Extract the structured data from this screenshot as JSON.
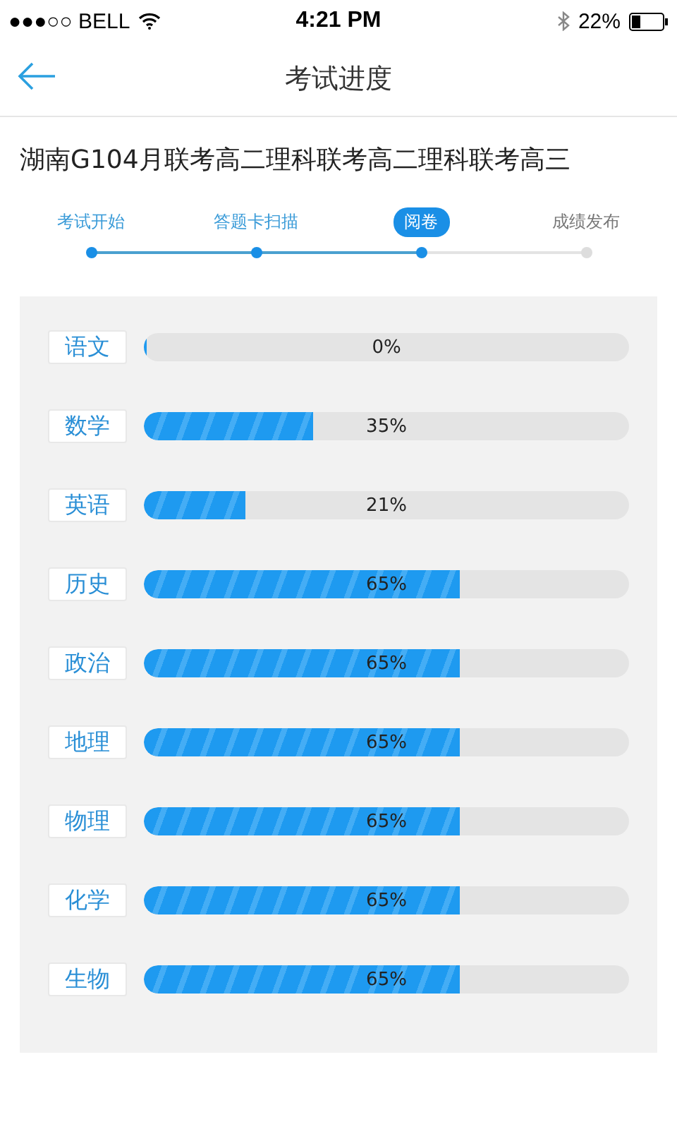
{
  "status_bar": {
    "carrier": "●●●○○ BELL",
    "time": "4:21 PM",
    "battery": "22%"
  },
  "nav": {
    "title": "考试进度"
  },
  "exam_name": "湖南G104月联考高二理科联考高二理科联考高三",
  "steps": [
    {
      "label": "考试开始",
      "done": true,
      "selected": false
    },
    {
      "label": "答题卡扫描",
      "done": true,
      "selected": false
    },
    {
      "label": "阅卷",
      "done": true,
      "selected": true
    },
    {
      "label": "成绩发布",
      "done": false,
      "selected": false
    }
  ],
  "subjects": [
    {
      "name": "语文",
      "level": 0,
      "reading": "0%"
    },
    {
      "name": "数学",
      "level": 0.35,
      "reading": "35%"
    },
    {
      "name": "英语",
      "level": 0.21,
      "reading": "21%"
    },
    {
      "name": "历史",
      "level": 0.65,
      "reading": "65%"
    },
    {
      "name": "政治",
      "level": 0.65,
      "reading": "65%"
    },
    {
      "name": "地理",
      "level": 0.65,
      "reading": "65%"
    },
    {
      "name": "物理",
      "level": 0.65,
      "reading": "65%"
    },
    {
      "name": "化学",
      "level": 0.65,
      "reading": "65%"
    },
    {
      "name": "生物",
      "level": 0.65,
      "reading": "65%"
    }
  ]
}
